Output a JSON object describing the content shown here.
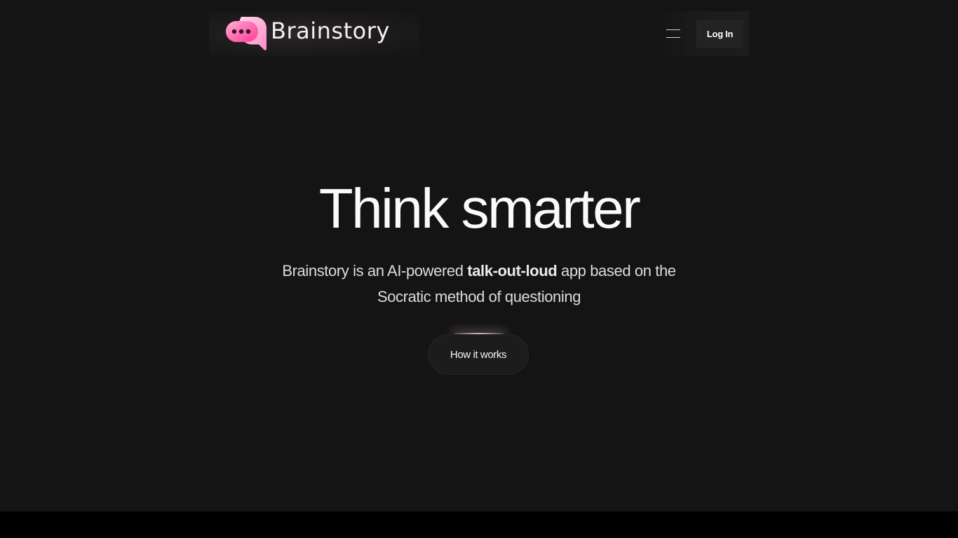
{
  "brand": {
    "name": "Brainstory",
    "logo_icon": "chat-bubble-icon",
    "accent_color": "#ff5ea8"
  },
  "header": {
    "menu_icon": "hamburger-menu-icon",
    "login_label": "Log In"
  },
  "hero": {
    "title": "Think smarter",
    "subtitle_before": "Brainstory is an AI-powered ",
    "subtitle_bold": "talk-out-loud",
    "subtitle_after": " app based on the Socratic method of questioning",
    "cta_label": "How it works"
  },
  "colors": {
    "background": "#141414",
    "button_background": "#1c1c1c",
    "text": "#fafafa"
  }
}
